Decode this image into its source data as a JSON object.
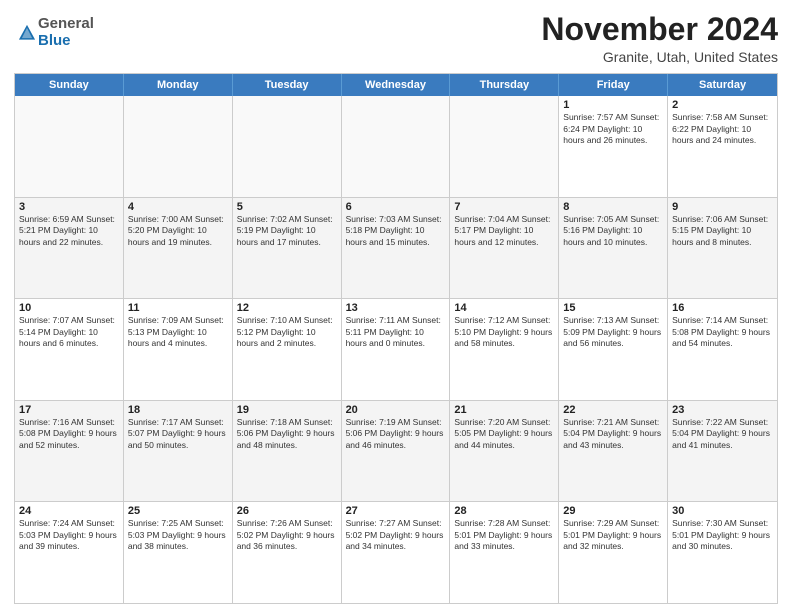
{
  "logo": {
    "general": "General",
    "blue": "Blue"
  },
  "title": {
    "month": "November 2024",
    "location": "Granite, Utah, United States"
  },
  "header": {
    "days": [
      "Sunday",
      "Monday",
      "Tuesday",
      "Wednesday",
      "Thursday",
      "Friday",
      "Saturday"
    ]
  },
  "weeks": [
    [
      {
        "day": "",
        "info": ""
      },
      {
        "day": "",
        "info": ""
      },
      {
        "day": "",
        "info": ""
      },
      {
        "day": "",
        "info": ""
      },
      {
        "day": "",
        "info": ""
      },
      {
        "day": "1",
        "info": "Sunrise: 7:57 AM\nSunset: 6:24 PM\nDaylight: 10 hours and 26 minutes."
      },
      {
        "day": "2",
        "info": "Sunrise: 7:58 AM\nSunset: 6:22 PM\nDaylight: 10 hours and 24 minutes."
      }
    ],
    [
      {
        "day": "3",
        "info": "Sunrise: 6:59 AM\nSunset: 5:21 PM\nDaylight: 10 hours and 22 minutes."
      },
      {
        "day": "4",
        "info": "Sunrise: 7:00 AM\nSunset: 5:20 PM\nDaylight: 10 hours and 19 minutes."
      },
      {
        "day": "5",
        "info": "Sunrise: 7:02 AM\nSunset: 5:19 PM\nDaylight: 10 hours and 17 minutes."
      },
      {
        "day": "6",
        "info": "Sunrise: 7:03 AM\nSunset: 5:18 PM\nDaylight: 10 hours and 15 minutes."
      },
      {
        "day": "7",
        "info": "Sunrise: 7:04 AM\nSunset: 5:17 PM\nDaylight: 10 hours and 12 minutes."
      },
      {
        "day": "8",
        "info": "Sunrise: 7:05 AM\nSunset: 5:16 PM\nDaylight: 10 hours and 10 minutes."
      },
      {
        "day": "9",
        "info": "Sunrise: 7:06 AM\nSunset: 5:15 PM\nDaylight: 10 hours and 8 minutes."
      }
    ],
    [
      {
        "day": "10",
        "info": "Sunrise: 7:07 AM\nSunset: 5:14 PM\nDaylight: 10 hours and 6 minutes."
      },
      {
        "day": "11",
        "info": "Sunrise: 7:09 AM\nSunset: 5:13 PM\nDaylight: 10 hours and 4 minutes."
      },
      {
        "day": "12",
        "info": "Sunrise: 7:10 AM\nSunset: 5:12 PM\nDaylight: 10 hours and 2 minutes."
      },
      {
        "day": "13",
        "info": "Sunrise: 7:11 AM\nSunset: 5:11 PM\nDaylight: 10 hours and 0 minutes."
      },
      {
        "day": "14",
        "info": "Sunrise: 7:12 AM\nSunset: 5:10 PM\nDaylight: 9 hours and 58 minutes."
      },
      {
        "day": "15",
        "info": "Sunrise: 7:13 AM\nSunset: 5:09 PM\nDaylight: 9 hours and 56 minutes."
      },
      {
        "day": "16",
        "info": "Sunrise: 7:14 AM\nSunset: 5:08 PM\nDaylight: 9 hours and 54 minutes."
      }
    ],
    [
      {
        "day": "17",
        "info": "Sunrise: 7:16 AM\nSunset: 5:08 PM\nDaylight: 9 hours and 52 minutes."
      },
      {
        "day": "18",
        "info": "Sunrise: 7:17 AM\nSunset: 5:07 PM\nDaylight: 9 hours and 50 minutes."
      },
      {
        "day": "19",
        "info": "Sunrise: 7:18 AM\nSunset: 5:06 PM\nDaylight: 9 hours and 48 minutes."
      },
      {
        "day": "20",
        "info": "Sunrise: 7:19 AM\nSunset: 5:06 PM\nDaylight: 9 hours and 46 minutes."
      },
      {
        "day": "21",
        "info": "Sunrise: 7:20 AM\nSunset: 5:05 PM\nDaylight: 9 hours and 44 minutes."
      },
      {
        "day": "22",
        "info": "Sunrise: 7:21 AM\nSunset: 5:04 PM\nDaylight: 9 hours and 43 minutes."
      },
      {
        "day": "23",
        "info": "Sunrise: 7:22 AM\nSunset: 5:04 PM\nDaylight: 9 hours and 41 minutes."
      }
    ],
    [
      {
        "day": "24",
        "info": "Sunrise: 7:24 AM\nSunset: 5:03 PM\nDaylight: 9 hours and 39 minutes."
      },
      {
        "day": "25",
        "info": "Sunrise: 7:25 AM\nSunset: 5:03 PM\nDaylight: 9 hours and 38 minutes."
      },
      {
        "day": "26",
        "info": "Sunrise: 7:26 AM\nSunset: 5:02 PM\nDaylight: 9 hours and 36 minutes."
      },
      {
        "day": "27",
        "info": "Sunrise: 7:27 AM\nSunset: 5:02 PM\nDaylight: 9 hours and 34 minutes."
      },
      {
        "day": "28",
        "info": "Sunrise: 7:28 AM\nSunset: 5:01 PM\nDaylight: 9 hours and 33 minutes."
      },
      {
        "day": "29",
        "info": "Sunrise: 7:29 AM\nSunset: 5:01 PM\nDaylight: 9 hours and 32 minutes."
      },
      {
        "day": "30",
        "info": "Sunrise: 7:30 AM\nSunset: 5:01 PM\nDaylight: 9 hours and 30 minutes."
      }
    ]
  ]
}
